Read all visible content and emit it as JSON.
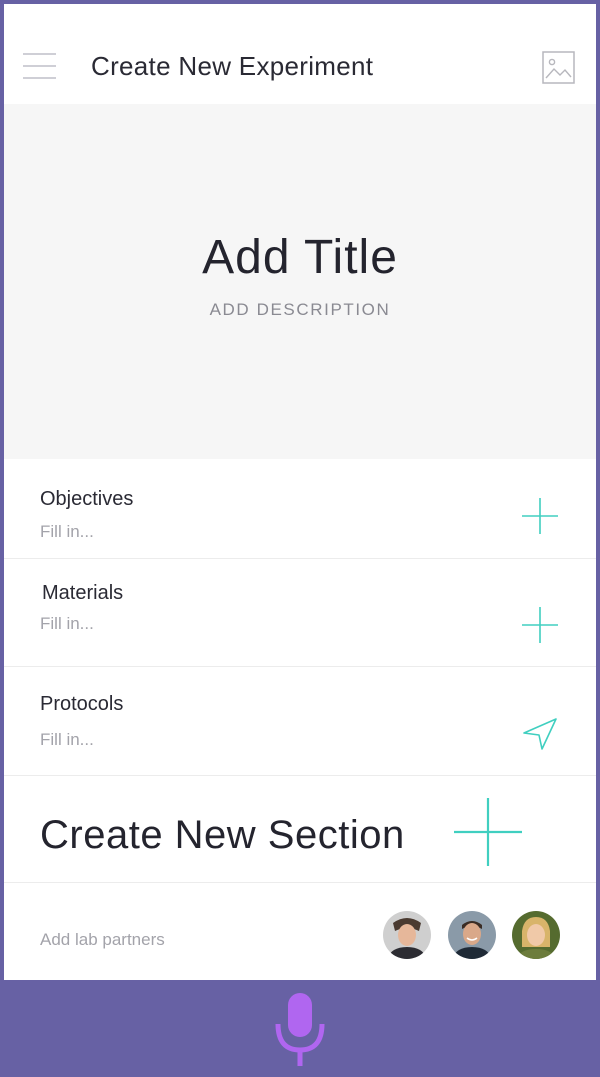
{
  "header": {
    "title": "Create New Experiment",
    "menu_icon": "hamburger-menu-icon",
    "image_icon": "image-icon"
  },
  "hero": {
    "title": "Add Title",
    "description": "ADD DESCRIPTION"
  },
  "sections": [
    {
      "label": "Objectives",
      "placeholder": "Fill in...",
      "action_icon": "plus-icon"
    },
    {
      "label": "Materials",
      "placeholder": "Fill in...",
      "action_icon": "plus-icon"
    },
    {
      "label": "Protocols",
      "placeholder": "Fill in...",
      "action_icon": "send-icon"
    }
  ],
  "create_section": {
    "label": "Create New Section",
    "action_icon": "plus-icon"
  },
  "partners": {
    "label": "Add lab partners",
    "avatars": [
      "avatar-1",
      "avatar-2",
      "avatar-3"
    ]
  },
  "footer": {
    "mic_icon": "microphone-icon"
  },
  "colors": {
    "accent": "#40cfc0",
    "background": "#6761a4",
    "mic": "#b066f0",
    "hero_bg": "#f6f6f6"
  }
}
